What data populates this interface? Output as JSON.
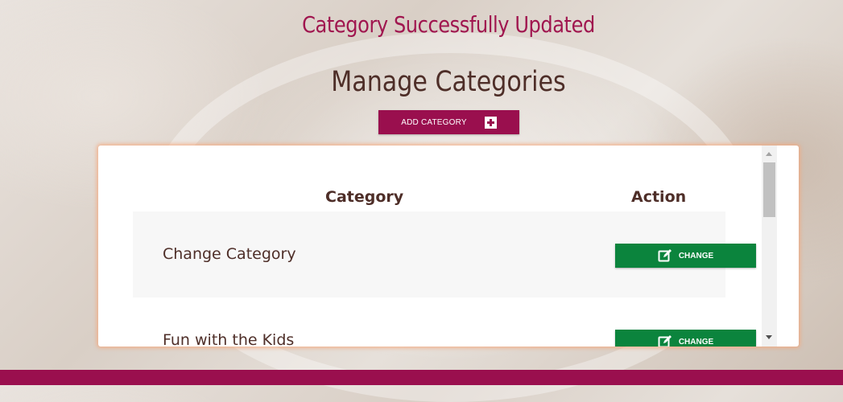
{
  "status_message": "Category Successfully Updated",
  "page_title": "Manage Categories",
  "add_button": {
    "label": "ADD CATEGORY",
    "icon": "plus-square-icon"
  },
  "table": {
    "headers": {
      "category": "Category",
      "action": "Action"
    },
    "rows": [
      {
        "name": "Change Category",
        "action_label": "CHANGE",
        "action_icon": "edit-icon"
      },
      {
        "name": "Fun with the Kids",
        "action_label": "CHANGE",
        "action_icon": "edit-icon"
      }
    ]
  },
  "colors": {
    "brand": "#9a0f4e",
    "status_text": "#a0164f",
    "title_text": "#4e2e28",
    "change_button": "#0b843d",
    "panel_glow": "#f5a578"
  }
}
